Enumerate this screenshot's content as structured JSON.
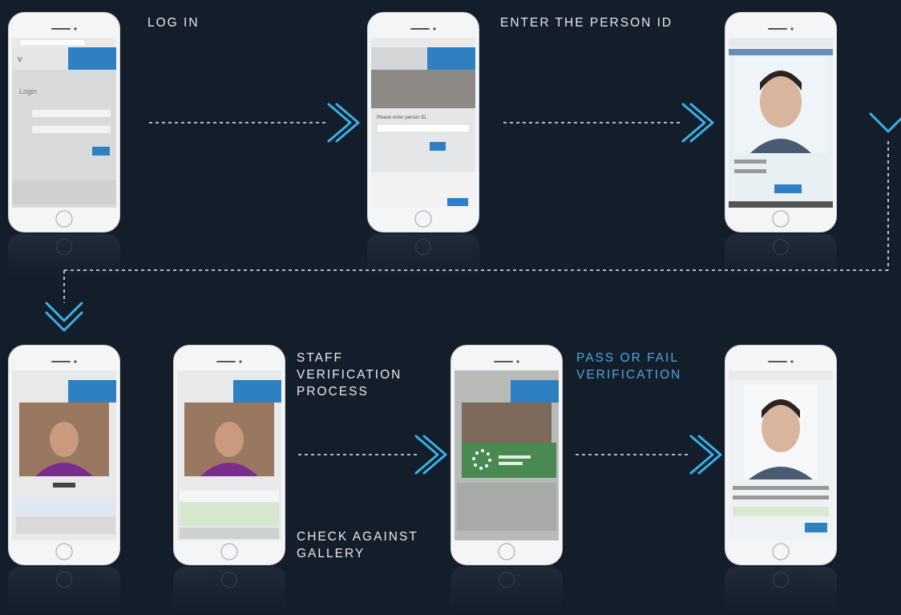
{
  "steps": {
    "login": "LOG IN",
    "enter_id": "ENTER THE PERSON ID",
    "staff_verification": [
      "STAFF",
      "VERIFICATION",
      "PROCESS"
    ],
    "pass_fail": [
      "PASS OR FAIL",
      "VERIFICATION"
    ],
    "check_gallery": [
      "CHECK AGAINST",
      "GALLERY"
    ]
  },
  "screens": {
    "login": {
      "heading": "Login"
    },
    "enter_id": {
      "prompt": "Please enter person ID"
    }
  },
  "colors": {
    "background": "#141d2a",
    "accent": "#3ab0e8",
    "pass_fail_text": "#4aa8df",
    "app_blue": "#2f80c2",
    "success_green": "#4a8a52"
  }
}
